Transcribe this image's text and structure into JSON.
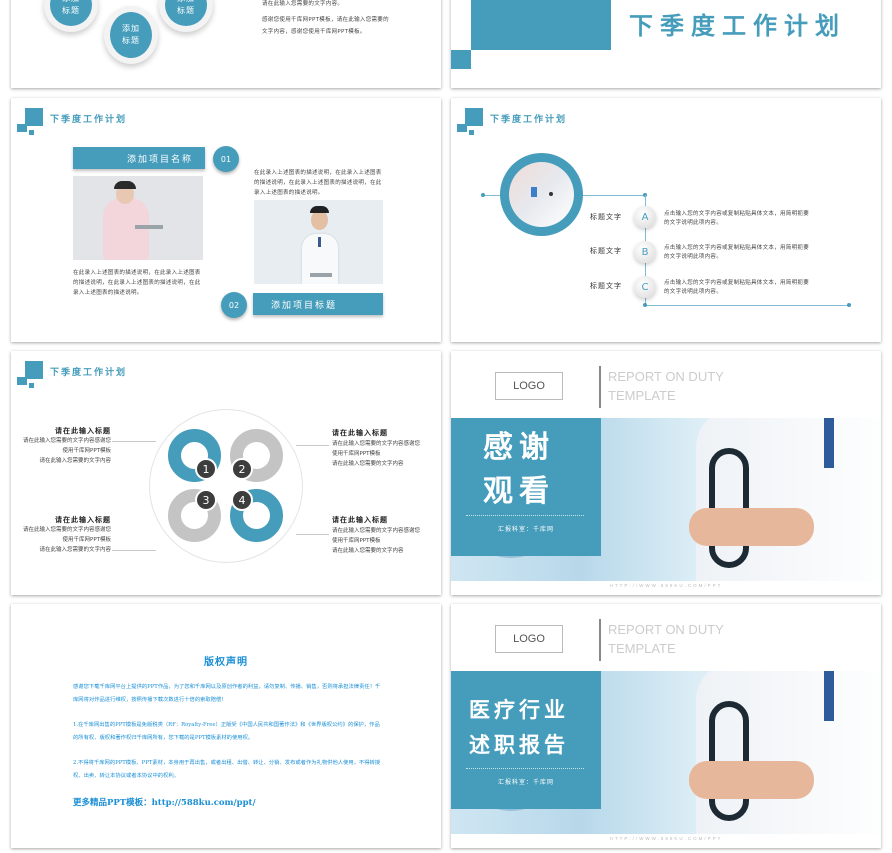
{
  "accent_color": "#469dbb",
  "slide1": {
    "drops": [
      "添加\n标题",
      "添加\n标题",
      "添加\n标题"
    ],
    "text_line1": "请在此输入您需要的文字内容。",
    "text_line2": "感谢您使用千库网PPT模板，请在此输入您需要的",
    "text_line3": "文字内容，感谢您使用千库网PPT模板。"
  },
  "slide2": {
    "title": "下季度工作计划"
  },
  "slide3": {
    "header": "下季度工作计划",
    "item1": {
      "label": "添加项目名称",
      "number": "01",
      "description": "在此录入上述图表的描述说明，在此录入上述图表的描述说明，在此录入上述图表的描述说明，在此录入上述图表的描述说明。"
    },
    "item2": {
      "label": "添加项目标题",
      "number": "02",
      "description": "在此录入上述图表的描述说明，在此录入上述图表的描述说明，在此录入上述图表的描述说明，在此录入上述图表的描述说明。"
    }
  },
  "slide4": {
    "header": "下季度工作计划",
    "items": [
      {
        "letter": "A",
        "title": "标题文字",
        "text": "点击输入您的文字内容或复制粘贴具体文本，用简明扼要的文字说明此项内容。"
      },
      {
        "letter": "B",
        "title": "标题文字",
        "text": "点击输入您的文字内容或复制粘贴具体文本，用简明扼要的文字说明此项内容。"
      },
      {
        "letter": "C",
        "title": "标题文字",
        "text": "点击输入您的文字内容或复制粘贴具体文本，用简明扼要的文字说明此项内容。"
      }
    ]
  },
  "slide5": {
    "header": "下季度工作计划",
    "quadrants": [
      {
        "number": "1",
        "title": "请在此输入标题",
        "line1": "请在此输入您需要的文字内容感谢您",
        "line2": "使用千库网PPT模板",
        "line3": "请在此输入您需要的文字内容"
      },
      {
        "number": "2",
        "title": "请在此输入标题",
        "line1": "请在此输入您需要的文字内容感谢您",
        "line2": "使用千库网PPT模板",
        "line3": "请在此输入您需要的文字内容"
      },
      {
        "number": "3",
        "title": "请在此输入标题",
        "line1": "请在此输入您需要的文字内容感谢您",
        "line2": "使用千库网PPT模板",
        "line3": "请在此输入您需要的文字内容"
      },
      {
        "number": "4",
        "title": "请在此输入标题",
        "line1": "请在此输入您需要的文字内容感谢您",
        "line2": "使用千库网PPT模板",
        "line3": "请在此输入您需要的文字内容"
      }
    ]
  },
  "slide6": {
    "logo": "LOGO",
    "eng_line1": "REPORT ON DUTY",
    "eng_line2": "TEMPLATE",
    "title_line1": "感谢",
    "title_line2": "观看",
    "subtitle": "汇报科室：千库网",
    "footer": "HTTP://WWW.588KU.COM/PPT"
  },
  "slide7": {
    "title": "版权声明",
    "para1": "感谢您下载千库网平台上提供的PPT作品，为了您和千库网以及原创作者的利益，请勿复制、传播、销售，否则将承担法律责任！千库网将对作品进行维权，按照传播下载次数进行十倍的索取赔偿！",
    "para2": "1.在千库网出售的PPT模板是免版税类（RF：Royalty-Free）正版受《中国人民共和国著作法》和《世界版权公约》的保护，作品的所有权、版权和著作权归千库网所有，您下载的是PPT模板素材的使用权。",
    "para3": "2.不得将千库网的PPT模板、PPT素材，本身用于再出售，或者出租、出借、转让、分销、发布或者作为礼物供他人使用，不得转授权、出卖、转让本协议或者本协议中的权利。",
    "more": "更多精品PPT模板：http://588ku.com/ppt/"
  },
  "slide8": {
    "logo": "LOGO",
    "eng_line1": "REPORT ON DUTY",
    "eng_line2": "TEMPLATE",
    "title_line1": "医疗行业",
    "title_line2": "述职报告",
    "subtitle": "汇报科室：千库网",
    "footer": "HTTP://WWW.588KU.COM/PPT"
  }
}
